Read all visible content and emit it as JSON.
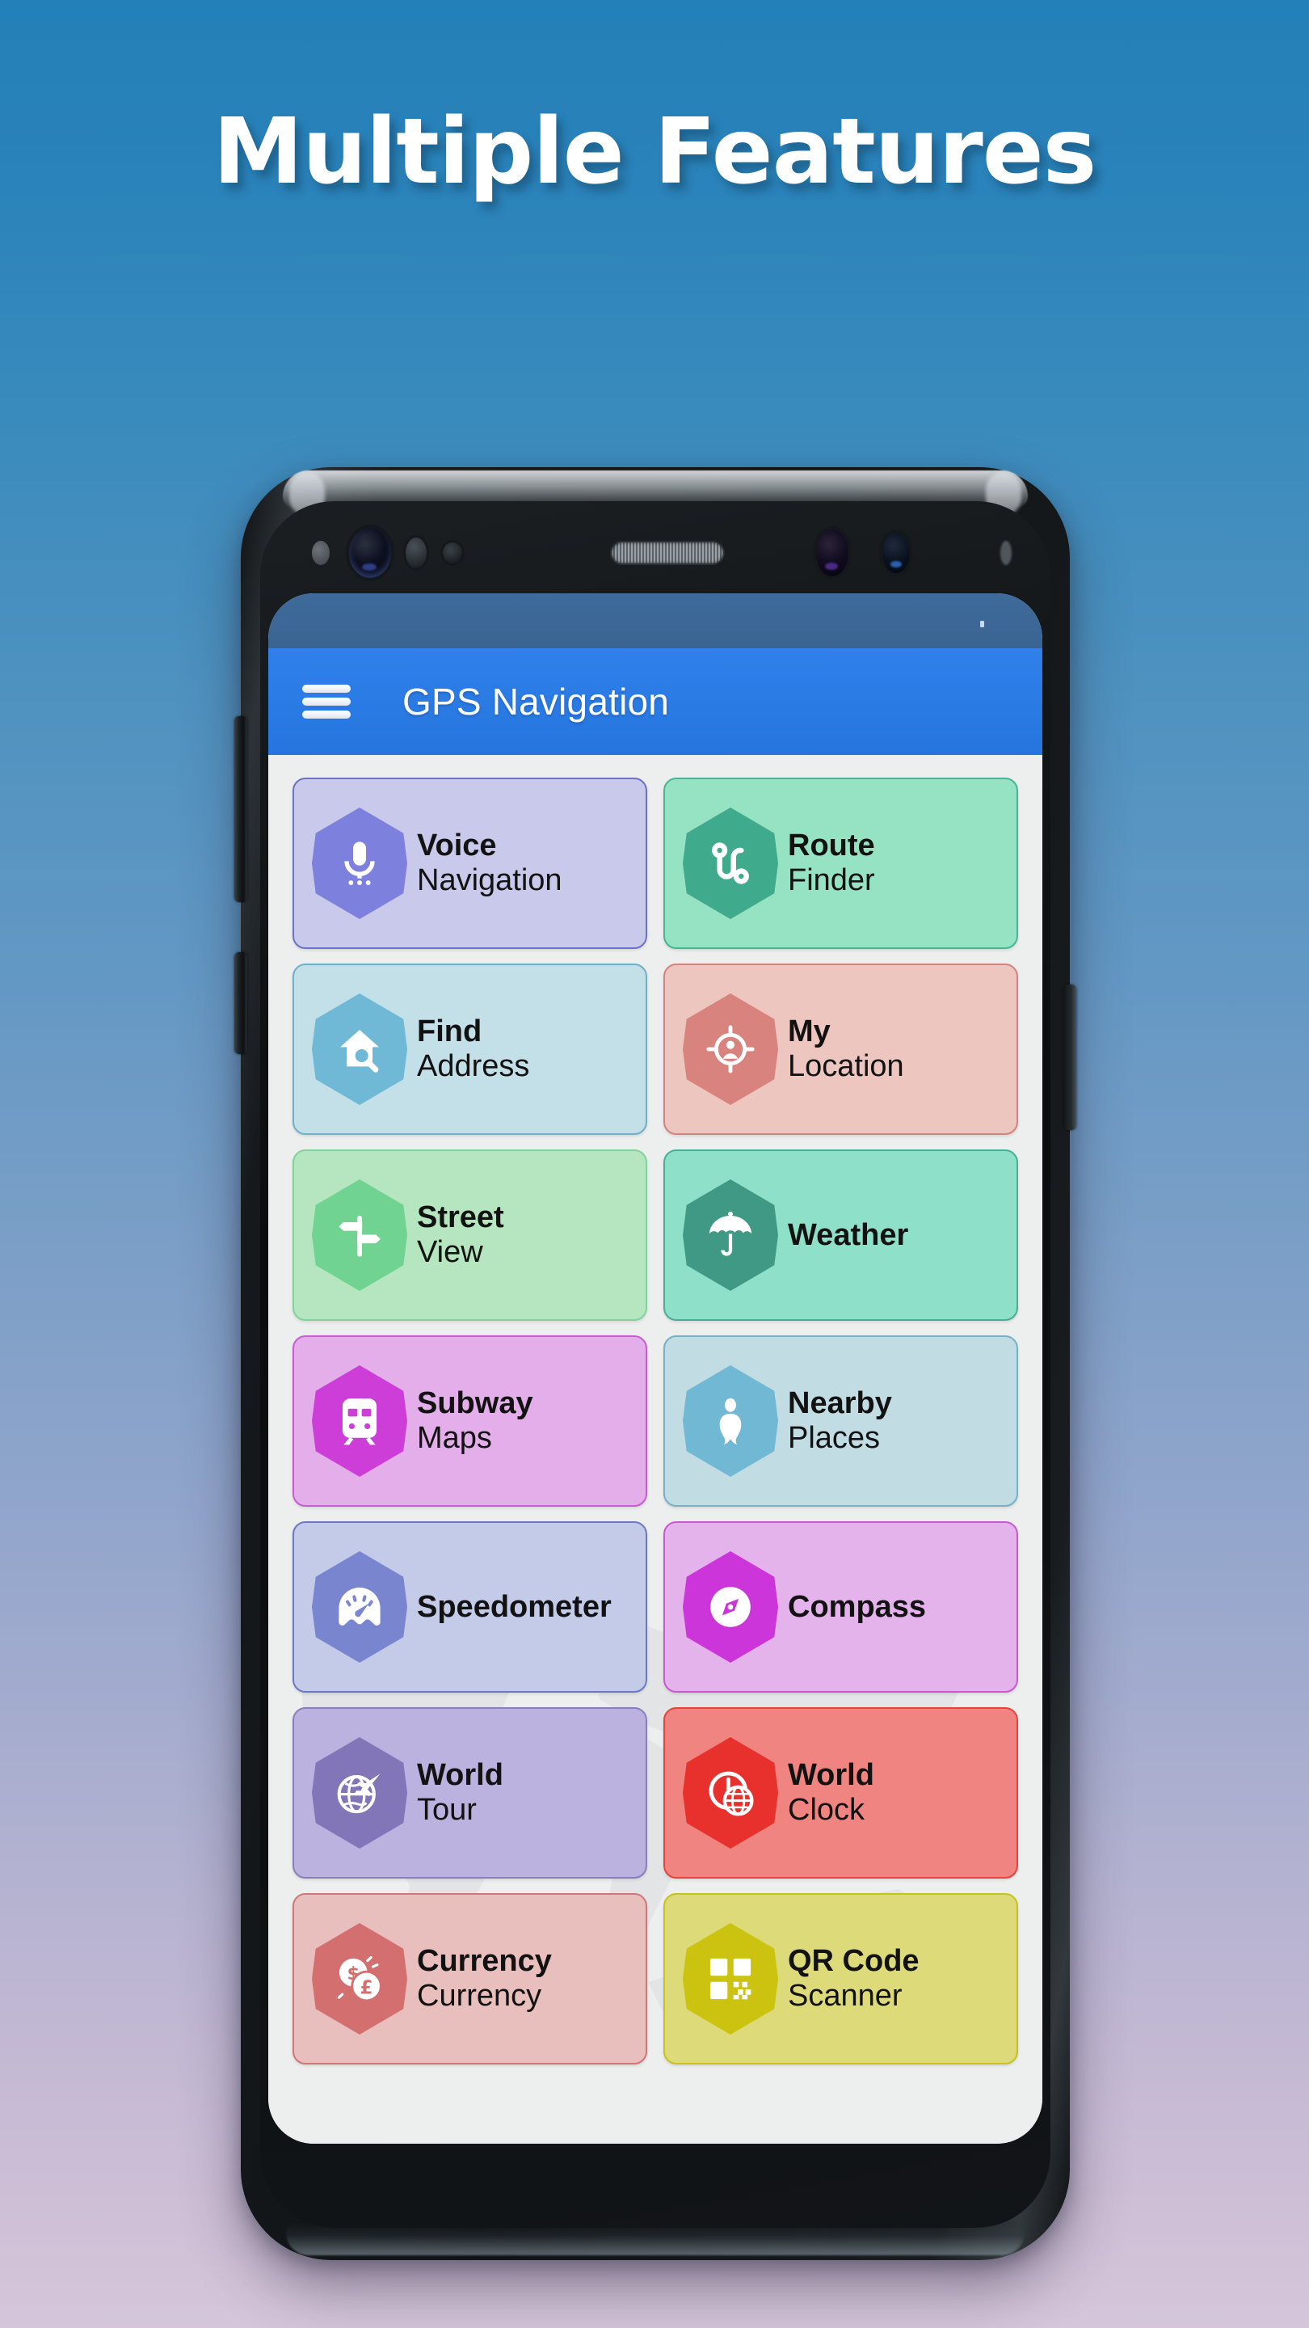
{
  "headline": "Multiple Features",
  "background": {
    "top_color": "#2480b8",
    "bottom_color": "#d5c6da"
  },
  "phone": {
    "frame_color": "#121518",
    "sensors": [
      "proximity-dot",
      "front-camera",
      "iris-sensor",
      "light-sensor",
      "earpiece-speaker",
      "iris-camera",
      "secondary-camera"
    ],
    "buttons": [
      "volume-rocker",
      "bixby-button",
      "power-button"
    ]
  },
  "app": {
    "statusbar_color": "#3a6491",
    "appbar": {
      "title": "GPS Navigation",
      "color": "#2a7ae4",
      "menu_icon": "hamburger-menu-icon"
    },
    "body_color": "#edeeee",
    "watermark": "world-map-watermark",
    "tiles": [
      {
        "line1": "Voice",
        "line2": "Navigation",
        "icon": "microphone-icon",
        "tile_color": "#c9c9ec",
        "badge_color": "#7f80dd",
        "border_color": "#6f70c8"
      },
      {
        "line1": "Route",
        "line2": "Finder",
        "icon": "route-path-icon",
        "tile_color": "#96e3c4",
        "badge_color": "#41ab8c",
        "border_color": "#46b793"
      },
      {
        "line1": "Find",
        "line2": "Address",
        "icon": "house-search-icon",
        "tile_color": "#c3dfe7",
        "badge_color": "#6fb8d6",
        "border_color": "#6fb0c6"
      },
      {
        "line1": "My",
        "line2": "Location",
        "icon": "location-target-person-icon",
        "tile_color": "#eec6c0",
        "badge_color": "#d9837f",
        "border_color": "#d4837e"
      },
      {
        "line1": "Street",
        "line2": "View",
        "icon": "signpost-icon",
        "tile_color": "#b6e6bf",
        "badge_color": "#70d393",
        "border_color": "#7fd49c"
      },
      {
        "line1": "Weather",
        "line2": "",
        "icon": "umbrella-icon",
        "tile_color": "#8fe0c8",
        "badge_color": "#409a85",
        "border_color": "#46b096"
      },
      {
        "line1": "Subway",
        "line2": "Maps",
        "icon": "train-icon",
        "tile_color": "#e3aeea",
        "badge_color": "#cd3fd8",
        "border_color": "#cb5bd4"
      },
      {
        "line1": "Nearby",
        "line2": "Places",
        "icon": "person-place-icon",
        "tile_color": "#c2dce4",
        "badge_color": "#71b9d4",
        "border_color": "#72b3c9"
      },
      {
        "line1": "Speedometer",
        "line2": "",
        "icon": "speedometer-icon",
        "tile_color": "#c3cbe8",
        "badge_color": "#7b86d0",
        "border_color": "#6b79c4"
      },
      {
        "line1": "Compass",
        "line2": "",
        "icon": "compass-icon",
        "tile_color": "#e5b3ec",
        "badge_color": "#cc36d9",
        "border_color": "#c958d2"
      },
      {
        "line1": "World",
        "line2": "Tour",
        "icon": "globe-plane-icon",
        "tile_color": "#bcb2e0",
        "badge_color": "#8275b8",
        "border_color": "#8a7fbd"
      },
      {
        "line1": "World",
        "line2": "Clock",
        "icon": "clock-globe-icon",
        "tile_color": "#ef8480",
        "badge_color": "#e8312c",
        "border_color": "#e8423d"
      },
      {
        "line1": "Currency",
        "line2": "Currency",
        "icon": "coins-icon",
        "tile_color": "#e8bfbd",
        "badge_color": "#d46f6f",
        "border_color": "#d07878"
      },
      {
        "line1": "QR Code",
        "line2": "Scanner",
        "icon": "qr-code-icon",
        "tile_color": "#dcda79",
        "badge_color": "#cbc40f",
        "border_color": "#c8c21d"
      }
    ]
  }
}
